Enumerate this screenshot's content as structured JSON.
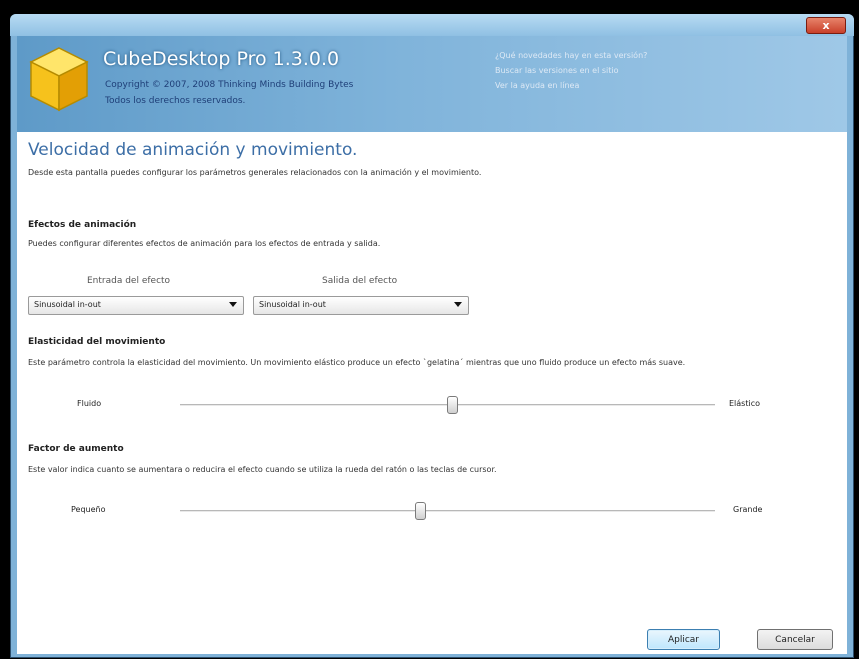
{
  "window": {
    "close_label": "x"
  },
  "header": {
    "app_title": "CubeDesktop Pro 1.3.0.0",
    "copyright": "Copyright © 2007, 2008 Thinking Minds Building Bytes",
    "rights": "Todos los derechos reservados.",
    "links": [
      "¿Qué novedades hay en esta versión?",
      "Buscar las versiones en el sitio",
      "Ver la ayuda en línea"
    ]
  },
  "content": {
    "title": "Velocidad de animación y movimiento.",
    "description": "Desde esta pantalla puedes configurar los parámetros generales relacionados con la animación y el movimiento.",
    "animation": {
      "heading": "Efectos de animación",
      "description": "Puedes configurar diferentes efectos de animación para los efectos de entrada y salida.",
      "entry_label": "Entrada del efecto",
      "entry_value": "Sinusoidal in-out",
      "exit_label": "Salida del efecto",
      "exit_value": "Sinusoidal in-out"
    },
    "elasticity": {
      "heading": "Elasticidad del movimiento",
      "description": "Este parámetro controla la elasticidad del movimiento. Un movimiento elástico produce un efecto `gelatina´ mientras que uno fluido produce un efecto más suave.",
      "min_label": "Fluido",
      "max_label": "Elástico",
      "level": 0.51
    },
    "zoom": {
      "heading": "Factor de aumento",
      "description": "Este valor indica cuanto se aumentara o reducira el efecto cuando se utiliza la rueda del ratón o las teclas de cursor.",
      "min_label": "Pequeño",
      "max_label": "Grande",
      "level": 0.45
    }
  },
  "buttons": {
    "apply": "Aplicar",
    "cancel": "Cancelar"
  }
}
